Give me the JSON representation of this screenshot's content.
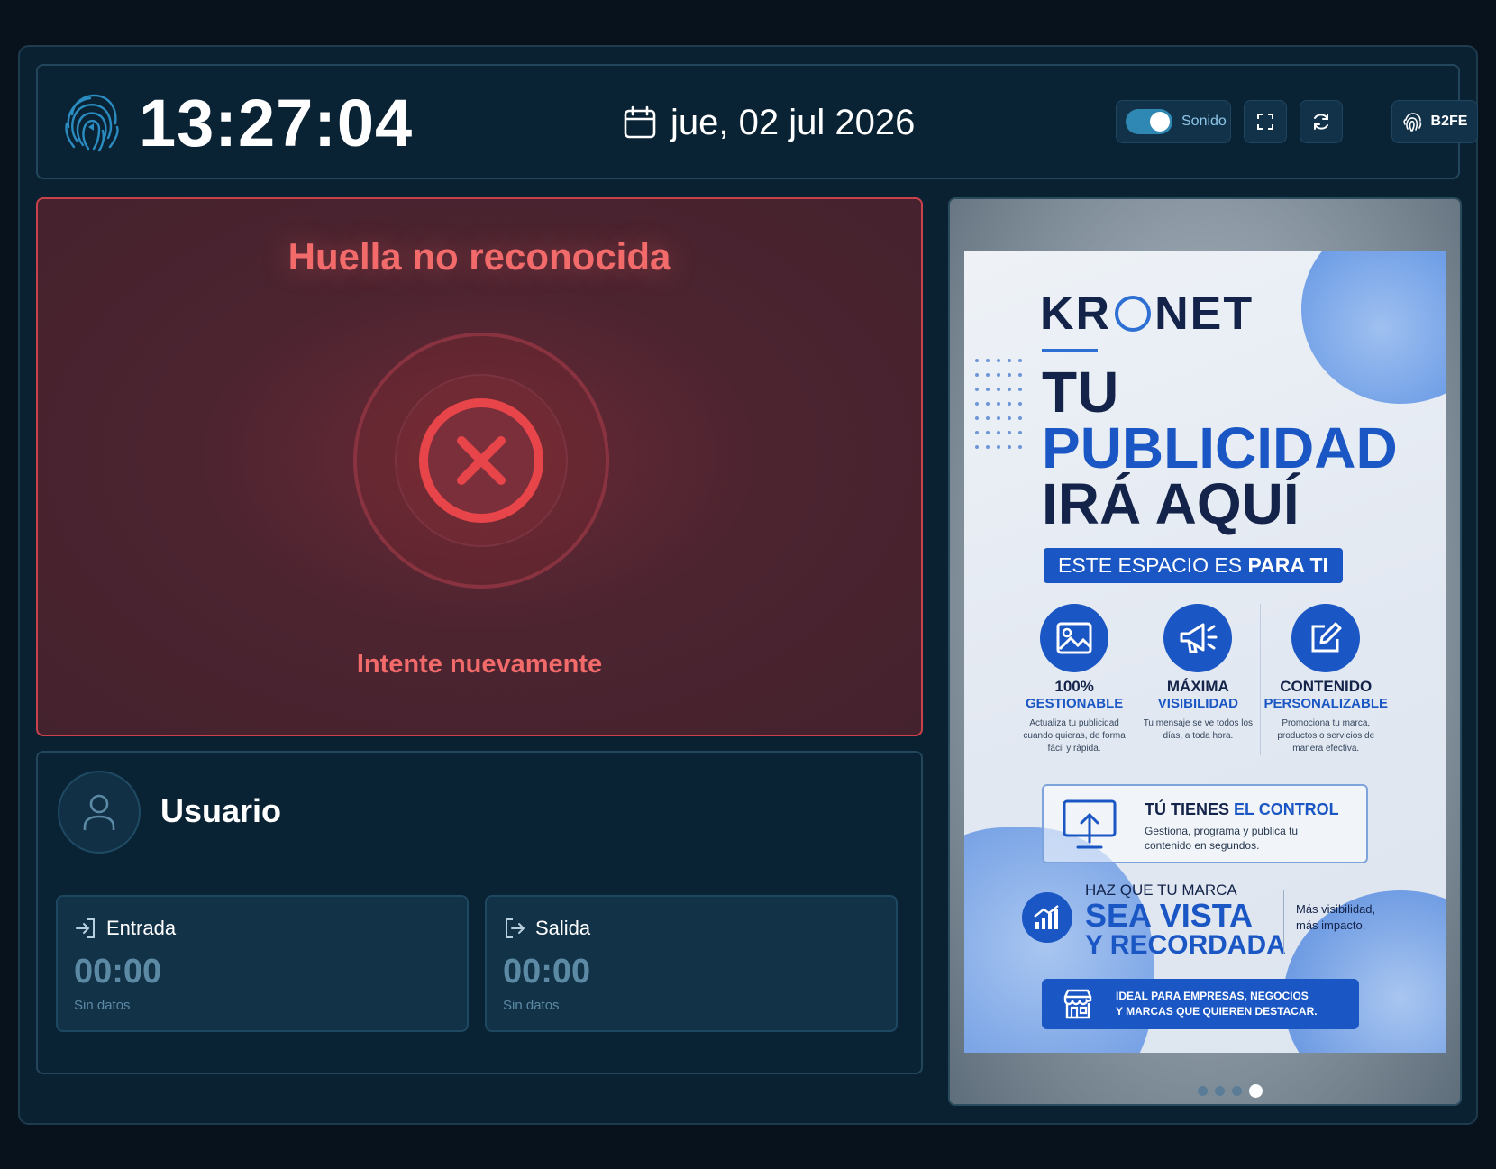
{
  "header": {
    "clock": "13:27:04",
    "date": "jue, 02 jul 2026",
    "sound_label": "Sonido",
    "sound_on": true,
    "device_id": "B2FE"
  },
  "status": {
    "title": "Huella no reconocida",
    "subtitle": "Intente nuevamente",
    "color": "#f26a6a"
  },
  "user": {
    "name": "Usuario",
    "entry": {
      "label": "Entrada",
      "time": "00:00",
      "status": "Sin datos"
    },
    "exit": {
      "label": "Salida",
      "time": "00:00",
      "status": "Sin datos"
    }
  },
  "ad": {
    "brand_left": "KR",
    "brand_right": "NET",
    "headline_1": "TU",
    "headline_2": "PUBLICIDAD",
    "headline_3": "IRÁ AQUÍ",
    "pill_normal": "ESTE ESPACIO ES ",
    "pill_bold": "PARA TI",
    "features": [
      {
        "t1": "100%",
        "t2": "GESTIONABLE",
        "desc": "Actualiza tu publicidad cuando quieras, de forma fácil y rápida."
      },
      {
        "t1": "MÁXIMA",
        "t2": "VISIBILIDAD",
        "desc": "Tu mensaje se ve todos los días, a toda hora."
      },
      {
        "t1": "CONTENIDO",
        "t2": "PERSONALIZABLE",
        "desc": "Promociona tu marca, productos o servicios de manera efectiva."
      }
    ],
    "control_title": "TÚ TIENES ",
    "control_title_accent": "EL CONTROL",
    "control_desc": "Gestiona, programa y publica tu contenido en segundos.",
    "marca_1": "HAZ QUE TU MARCA",
    "marca_2": "SEA VISTA",
    "marca_3": "Y RECORDADA",
    "marca_side": "Más visibilidad, más impacto.",
    "cta_line1": "IDEAL PARA EMPRESAS, NEGOCIOS",
    "cta_line2": "Y MARCAS QUE QUIEREN DESTACAR.",
    "slides_total": 4,
    "slide_active": 4
  },
  "colors": {
    "accent": "#2f88b3",
    "error": "#e8454b",
    "ad_blue": "#1a56c4"
  }
}
